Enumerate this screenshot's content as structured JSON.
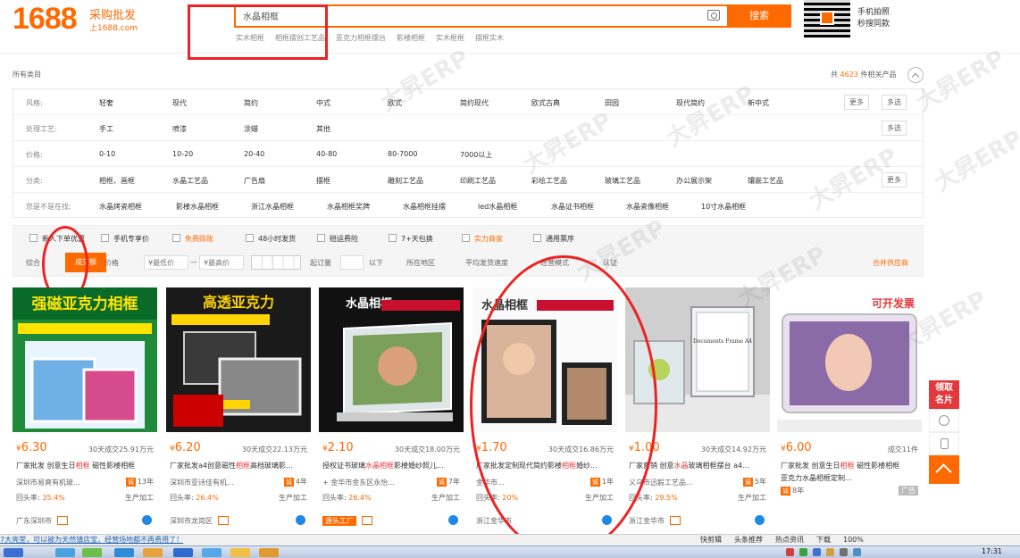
{
  "header": {
    "logo_number": "1688",
    "logo_tagline": "采购批发",
    "logo_domain": "上1688.com",
    "search_value": "水晶相框",
    "search_button": "搜索",
    "hot_words": [
      "实木相框",
      "相框摆创工艺品",
      "亚克力相框摆台",
      "影楼相框",
      "实木框框",
      "摆框实木"
    ],
    "mobile_text_line1": "手机拍照",
    "mobile_text_line2": "秒搜同款"
  },
  "filters": {
    "all_categories": "所有类目",
    "result_prefix": "共",
    "result_count": "4623",
    "result_suffix": "件相关产品",
    "rows": [
      {
        "label": "风格:",
        "options": [
          "轻奢",
          "现代",
          "简约",
          "中式",
          "欧式",
          "简约现代",
          "欧式古典",
          "田园",
          "现代简约",
          "新中式"
        ],
        "more": "更多",
        "multi": "多选"
      },
      {
        "label": "处理工艺:",
        "options": [
          "手工",
          "喷漆",
          "涂蜡",
          "其他"
        ],
        "multi": "多选"
      },
      {
        "label": "价格:",
        "options": [
          "0-10",
          "10-20",
          "20-40",
          "40-80",
          "80-7000",
          "7000以上"
        ]
      },
      {
        "label": "分类:",
        "options": [
          "相框、画框",
          "水晶工艺品",
          "广告扇",
          "摆框",
          "雕刻工艺品",
          "印刷工艺品",
          "彩绘工艺品",
          "玻璃工艺品",
          "办公展示架",
          "镶嵌工艺品"
        ],
        "more": "更多"
      },
      {
        "label": "您是不是在找:",
        "options": [
          "水晶烤瓷相框",
          "影楼水晶相框",
          "浙江水晶相框",
          "水晶相框奖牌",
          "水晶相框挂摆",
          "led水晶相框",
          "水晶证书相框",
          "水晶瓷像相框",
          "10寸水晶相框"
        ]
      }
    ]
  },
  "sortbar": {
    "checks": [
      "新人下单优惠",
      "手机专享价",
      "免费赊账",
      "48小时发货",
      "赔运费险",
      "7+天包换",
      "实力商家",
      "通用票序"
    ],
    "sort_general": "综合",
    "sort_active": "成交额",
    "sort_price": "价格",
    "price_min_placeholder": "¥最低价",
    "price_dash": "—",
    "price_max_placeholder": "¥最高价",
    "moq_label": "起订量",
    "moq_suffix": "以下",
    "region": "所在地区",
    "delivery": "平均发货速度",
    "business_mode": "经营模式",
    "cert": "认证",
    "merge": "合并供应商"
  },
  "products": [
    {
      "image_text": "强磁亚克力相框",
      "currency": "¥",
      "price": "6.30",
      "sold": "30天成交25.91万元",
      "title_prefix": "厂家批发 创意生日",
      "title_kw": "相框",
      "title_suffix": " 磁性影楼相框",
      "company": "深圳市易爽有机玻...",
      "years": "13年",
      "repurchase": "回头率:",
      "rate": "35.4%",
      "type": "生产加工",
      "location": "广东深圳市"
    },
    {
      "image_text": "高透亚克力",
      "currency": "¥",
      "price": "6.20",
      "sold": "30天成交22.13万元",
      "title_prefix": "厂家批发a4创意磁性",
      "title_kw": "相框",
      "title_suffix": "高档玻璃影...",
      "company": "深圳市亚诗佳有机...",
      "years": "4年",
      "repurchase": "回头率:",
      "rate": "26.4%",
      "type": "生产加工",
      "location": "深圳市龙岗区"
    },
    {
      "image_text": "水晶相框",
      "currency": "¥",
      "price": "2.10",
      "sold": "30天成交18.00万元",
      "title_prefix": "授权证书玻璃",
      "title_kw": "水晶相框",
      "title_suffix": "影楼婚纱照儿...",
      "company": "+ 金华市金东区永怡...",
      "years": "7年",
      "repurchase": "回头率:",
      "rate": "26.4%",
      "type": "生产加工",
      "location": "源头工厂"
    },
    {
      "image_text": "水晶相框",
      "currency": "¥",
      "price": "1.70",
      "sold": "30天成交16.86万元",
      "title_prefix": "厂家批发定制现代简约影楼",
      "title_kw": "相框",
      "title_suffix": "婚纱...",
      "company": "金华市...",
      "years": "1年",
      "repurchase": "回头率:",
      "rate": "20%",
      "type": "生产加工",
      "location": "浙江金华市"
    },
    {
      "image_text": "Documents Frame A4",
      "currency": "¥",
      "price": "1.00",
      "sold": "30天成交14.92万元",
      "title_prefix": "厂家直销 创意",
      "title_kw": "水晶",
      "title_suffix": "玻璃相框摆台 a4...",
      "company": "义乌市迅毅工艺品...",
      "years": "5年",
      "repurchase": "回头率:",
      "rate": "29.5%",
      "type": "生产加工",
      "location": "浙江金华市"
    },
    {
      "image_text": "可开发票",
      "currency": "¥",
      "price": "6.00",
      "sold": "成交11件",
      "title_prefix": "厂家批发 创意生日",
      "title_kw": "相框",
      "title_suffix": " 磁性影楼相框",
      "company": "亚克力水晶相框定制...",
      "years": "8年",
      "repurchase": "",
      "rate": "",
      "type": "广告",
      "location": ""
    }
  ],
  "side": {
    "claim_line1": "领取",
    "claim_line2": "名片"
  },
  "status_bar": {
    "left": "7大亮堂，可以被为天然镇店宝，经营场地都不再费用了！",
    "items": [
      "快剪辑",
      "头条推荐",
      "热点资讯",
      "下载"
    ],
    "zoom": "100%"
  },
  "taskbar": {
    "time": "17:31"
  },
  "watermark": "大昇ERP",
  "colors": {
    "accent": "#ff6a00",
    "keyword": "#e4393c",
    "annotation": "#ee2222"
  }
}
